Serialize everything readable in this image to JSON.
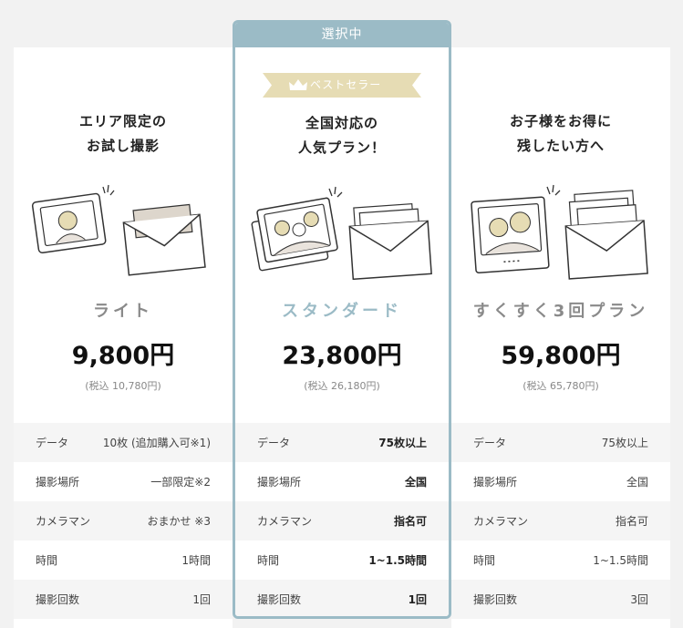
{
  "plans": [
    {
      "tagline": "エリア限定の\nお試し撮影",
      "name": "ライト",
      "price": "9,800円",
      "tax": "(税込 10,780円)",
      "rows": [
        {
          "label": "データ",
          "value": "10枚 (追加購入可※1)"
        },
        {
          "label": "撮影場所",
          "value": "一部限定※2"
        },
        {
          "label": "カメラマン",
          "value": "おまかせ ※3"
        },
        {
          "label": "時間",
          "value": "1時間"
        },
        {
          "label": "撮影回数",
          "value": "1回"
        }
      ]
    },
    {
      "selected_label": "選択中",
      "badge": "ベストセラー",
      "tagline": "全国対応の\n人気プラン！",
      "name": "スタンダード",
      "price": "23,800円",
      "tax": "(税込 26,180円)",
      "rows": [
        {
          "label": "データ",
          "value": "75枚以上"
        },
        {
          "label": "撮影場所",
          "value": "全国"
        },
        {
          "label": "カメラマン",
          "value": "指名可"
        },
        {
          "label": "時間",
          "value": "1~1.5時間"
        },
        {
          "label": "撮影回数",
          "value": "1回"
        }
      ]
    },
    {
      "tagline": "お子様をお得に\n残したい方へ",
      "name": "すくすく3回プラン",
      "price": "59,800円",
      "tax": "(税込 65,780円)",
      "rows": [
        {
          "label": "データ",
          "value": "75枚以上"
        },
        {
          "label": "撮影場所",
          "value": "全国"
        },
        {
          "label": "カメラマン",
          "value": "指名可"
        },
        {
          "label": "時間",
          "value": "1~1.5時間"
        },
        {
          "label": "撮影回数",
          "value": "3回"
        }
      ]
    }
  ],
  "colors": {
    "accent": "#9bbbc6",
    "badge": "#e6dcb4",
    "row_alt": "#f5f5f5"
  }
}
